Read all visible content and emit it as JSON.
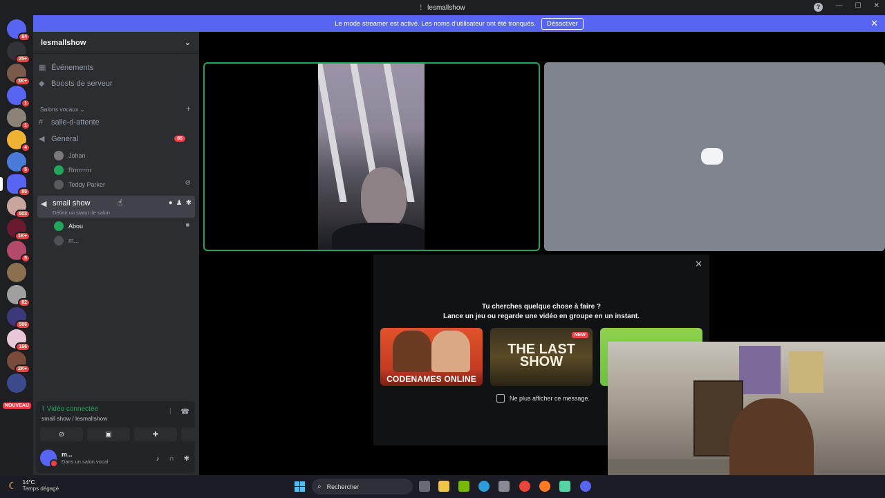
{
  "window": {
    "title": "lesmallshow",
    "help_label": "?"
  },
  "banner": {
    "text": "Le mode streamer est activé. Les noms d'utilisateur ont été tronqués.",
    "button": "Désactiver"
  },
  "servers": [
    {
      "badge": "84"
    },
    {
      "badge": "25+"
    },
    {
      "badge": "3K+"
    },
    {
      "badge": "1"
    },
    {
      "badge": "1"
    },
    {
      "badge": "4"
    },
    {
      "badge": "5"
    },
    {
      "badge": "85"
    },
    {
      "badge": "503"
    },
    {
      "badge": "1K+"
    },
    {
      "badge": "5"
    },
    {
      "badge": ""
    },
    {
      "badge": "82"
    },
    {
      "badge": "586"
    },
    {
      "badge": "166"
    },
    {
      "badge": "2K+"
    },
    {
      "badge": ""
    }
  ],
  "servers_new_label": "NOUVEAU",
  "guild": {
    "name": "lesmallshow"
  },
  "channels": {
    "events": "Événements",
    "boosts": "Boosts de serveur",
    "category": "Salons vocaux",
    "waiting": "salle-d-attente",
    "general": "Général",
    "general_badge": "85",
    "general_users": [
      "Johan",
      "Rrrrrrrrrr",
      "Teddy Parker"
    ],
    "active_name": "small show",
    "active_status": "Définir un statut de salon",
    "active_users": [
      "Abou",
      "m..."
    ]
  },
  "voice": {
    "title": "Vidéo connectée",
    "subtitle": "small show / lesmallshow",
    "user_name": "m...",
    "user_status": "Dans un salon vocal"
  },
  "activity": {
    "heading": "Tu cherches quelque chose à faire ?",
    "subheading": "Lance un jeu ou regarde une vidéo en groupe en un instant.",
    "games": [
      "CODENAMES ONLINE",
      "THE LAST SHOW"
    ],
    "new_badge": "NEW",
    "checkbox_label": "Ne plus afficher ce message."
  },
  "taskbar": {
    "temperature": "14°C",
    "weather": "Temps dégagé",
    "search_placeholder": "Rechercher"
  },
  "colors": {
    "accent": "#5865f2",
    "online": "#23a55a",
    "badge": "#f23f43",
    "bg": "#1e1f22",
    "sidebar": "#2b2d31"
  }
}
